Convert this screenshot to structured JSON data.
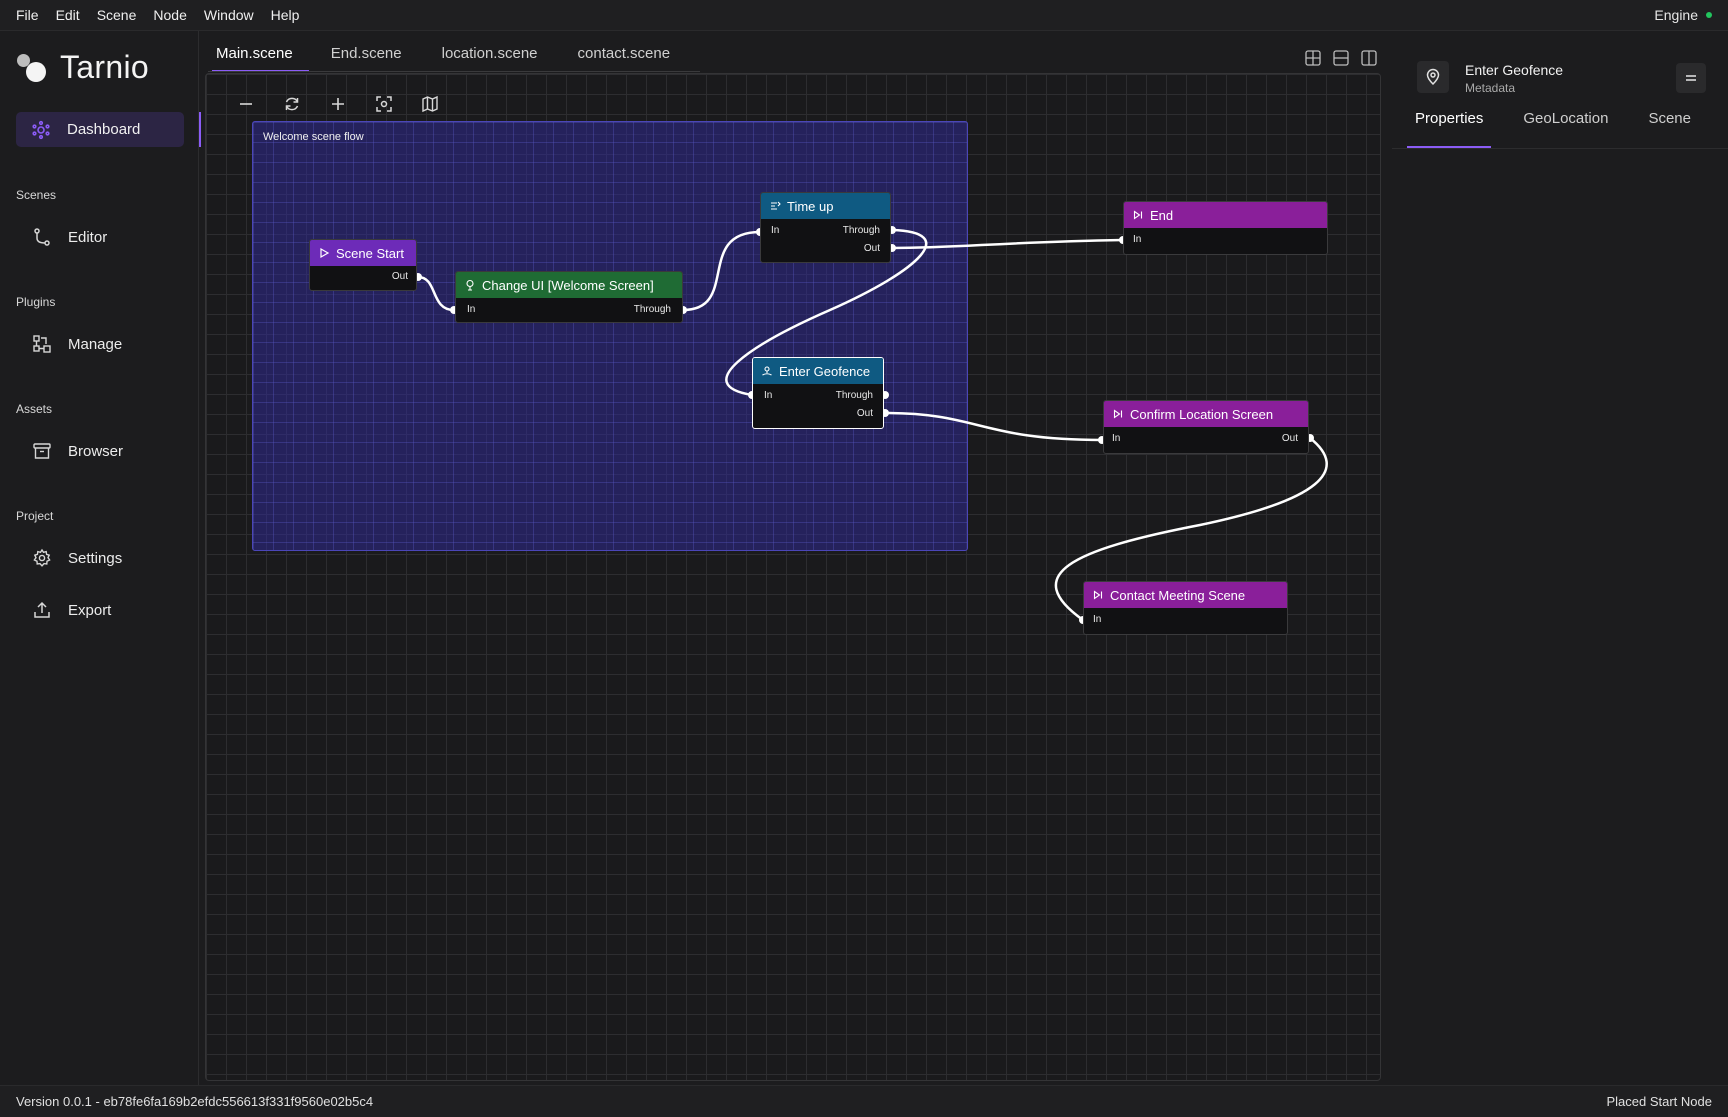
{
  "menubar": {
    "items": [
      "File",
      "Edit",
      "Scene",
      "Node",
      "Window",
      "Help"
    ],
    "engine_label": "Engine",
    "engine_status_color": "#22c55e"
  },
  "brand": {
    "name": "Tarnio"
  },
  "sidebar": {
    "dashboard": "Dashboard",
    "sections": {
      "scenes": "Scenes",
      "plugins": "Plugins",
      "assets": "Assets",
      "project": "Project"
    },
    "items": {
      "editor": "Editor",
      "manage": "Manage",
      "browser": "Browser",
      "settings": "Settings",
      "export": "Export"
    }
  },
  "tabs": [
    "Main.scene",
    "End.scene",
    "location.scene",
    "contact.scene"
  ],
  "canvas": {
    "group_title": "Welcome scene flow",
    "nodes": {
      "scene_start": {
        "title": "Scene Start",
        "out": "Out",
        "color": "#6d2bb8"
      },
      "change_ui": {
        "title": "Change UI [Welcome Screen]",
        "in": "In",
        "through": "Through",
        "color": "#1f6b34"
      },
      "time_up": {
        "title": "Time up",
        "in": "In",
        "through": "Through",
        "out": "Out",
        "color": "#0f5a82"
      },
      "enter_geofence": {
        "title": "Enter Geofence",
        "in": "In",
        "through": "Through",
        "out": "Out",
        "color": "#0f5a82"
      },
      "end": {
        "title": "End",
        "in": "In",
        "color": "#8a1f9a"
      },
      "confirm_location": {
        "title": "Confirm Location Screen",
        "in": "In",
        "out": "Out",
        "color": "#8a1f9a"
      },
      "contact_meeting": {
        "title": "Contact Meeting Scene",
        "in": "In",
        "color": "#8a1f9a"
      }
    }
  },
  "properties": {
    "title": "Enter Geofence",
    "subtitle": "Metadata",
    "tabs": [
      "Properties",
      "GeoLocation",
      "Scene"
    ]
  },
  "statusbar": {
    "version": "Version 0.0.1 - eb78fe6fa169b2efdc556613f331f9560e02b5c4",
    "message": "Placed Start Node"
  }
}
